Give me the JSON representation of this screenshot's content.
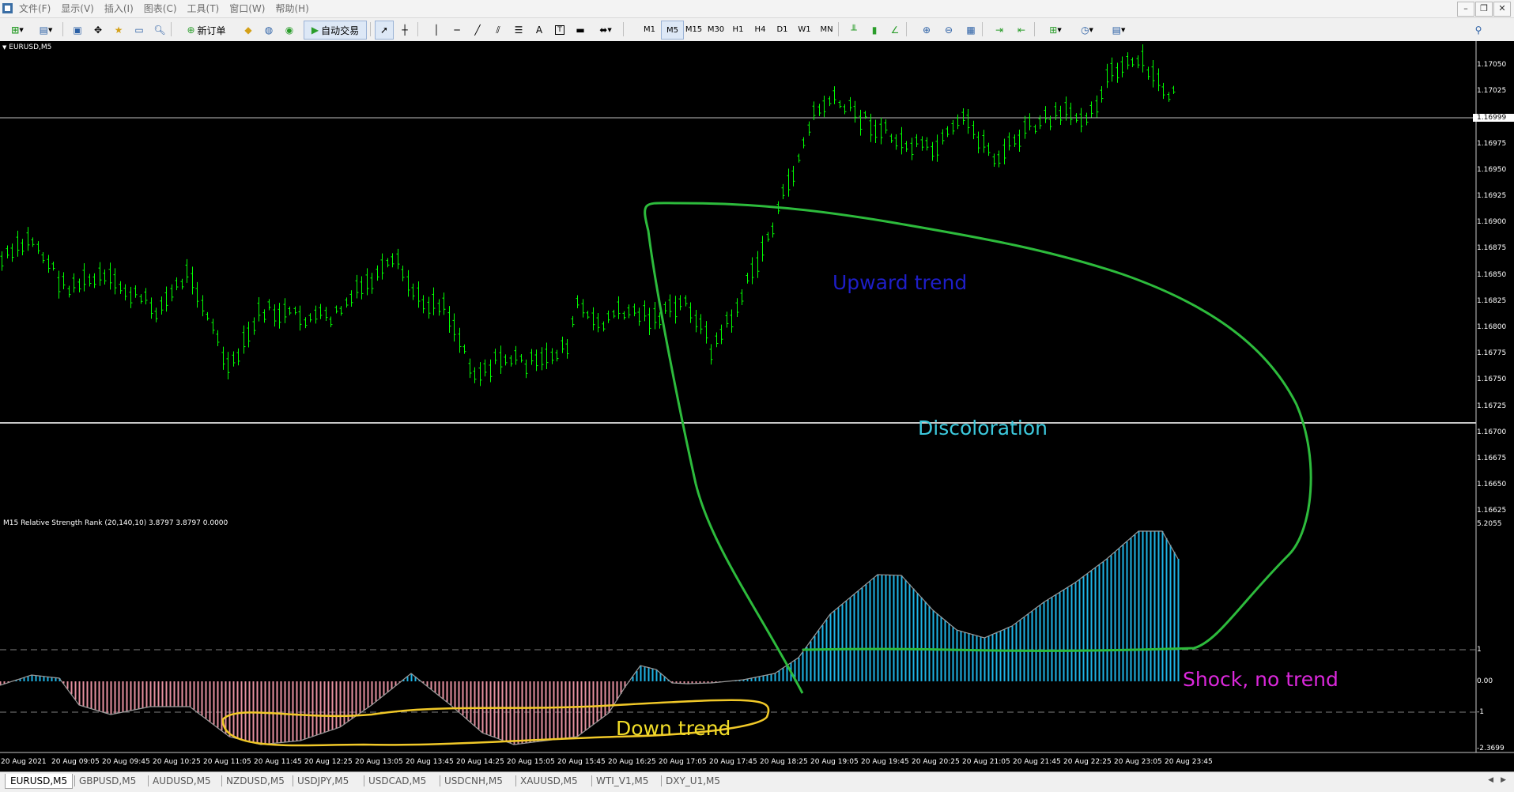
{
  "menu": {
    "items": [
      "文件(F)",
      "显示(V)",
      "插入(I)",
      "图表(C)",
      "工具(T)",
      "窗口(W)",
      "帮助(H)"
    ]
  },
  "toolbar": {
    "new_order": "新订单",
    "auto_trading": "自动交易",
    "timeframes": [
      "M1",
      "M5",
      "M15",
      "M30",
      "H1",
      "H4",
      "D1",
      "W1",
      "MN"
    ],
    "active_timeframe": "M5"
  },
  "chart": {
    "symbol_label": "EURUSD,M5",
    "indicator_label": "M15 Relative Strength Rank (20,140,10) 3.8797 3.8797 0.0000",
    "price_axis": [
      "1.17050",
      "1.17025",
      "1.16975",
      "1.16950",
      "1.16925",
      "1.16900",
      "1.16875",
      "1.16850",
      "1.16825",
      "1.16800",
      "1.16775",
      "1.16750",
      "1.16725",
      "1.16700",
      "1.16675",
      "1.16650",
      "1.16625"
    ],
    "current_price": "1.16999",
    "indicator_axis": [
      "5.2055",
      "1",
      "0.00",
      "-1",
      "-2.3699"
    ],
    "time_axis": [
      "20 Aug 2021",
      "20 Aug 09:05",
      "20 Aug 09:45",
      "20 Aug 10:25",
      "20 Aug 11:05",
      "20 Aug 11:45",
      "20 Aug 12:25",
      "20 Aug 13:05",
      "20 Aug 13:45",
      "20 Aug 14:25",
      "20 Aug 15:05",
      "20 Aug 15:45",
      "20 Aug 16:25",
      "20 Aug 17:05",
      "20 Aug 17:45",
      "20 Aug 18:25",
      "20 Aug 19:05",
      "20 Aug 19:45",
      "20 Aug 20:25",
      "20 Aug 21:05",
      "20 Aug 21:45",
      "20 Aug 22:25",
      "20 Aug 23:05",
      "20 Aug 23:45"
    ],
    "colors": {
      "candles": "#00ff00",
      "hist_up": "#1eb4e6",
      "hist_down": "#e691a0",
      "grid": "#808080"
    }
  },
  "annotations": {
    "upward": "Upward trend",
    "discoloration": "Discoloration",
    "shock": "Shock, no trend",
    "down": "Down trend"
  },
  "tabs": [
    "EURUSD,M5",
    "GBPUSD,M5",
    "AUDUSD,M5",
    "NZDUSD,M5",
    "USDJPY,M5",
    "USDCAD,M5",
    "USDCNH,M5",
    "XAUUSD,M5",
    "WTI_V1,M5",
    "DXY_U1,M5"
  ],
  "active_tab": "EURUSD,M5"
}
